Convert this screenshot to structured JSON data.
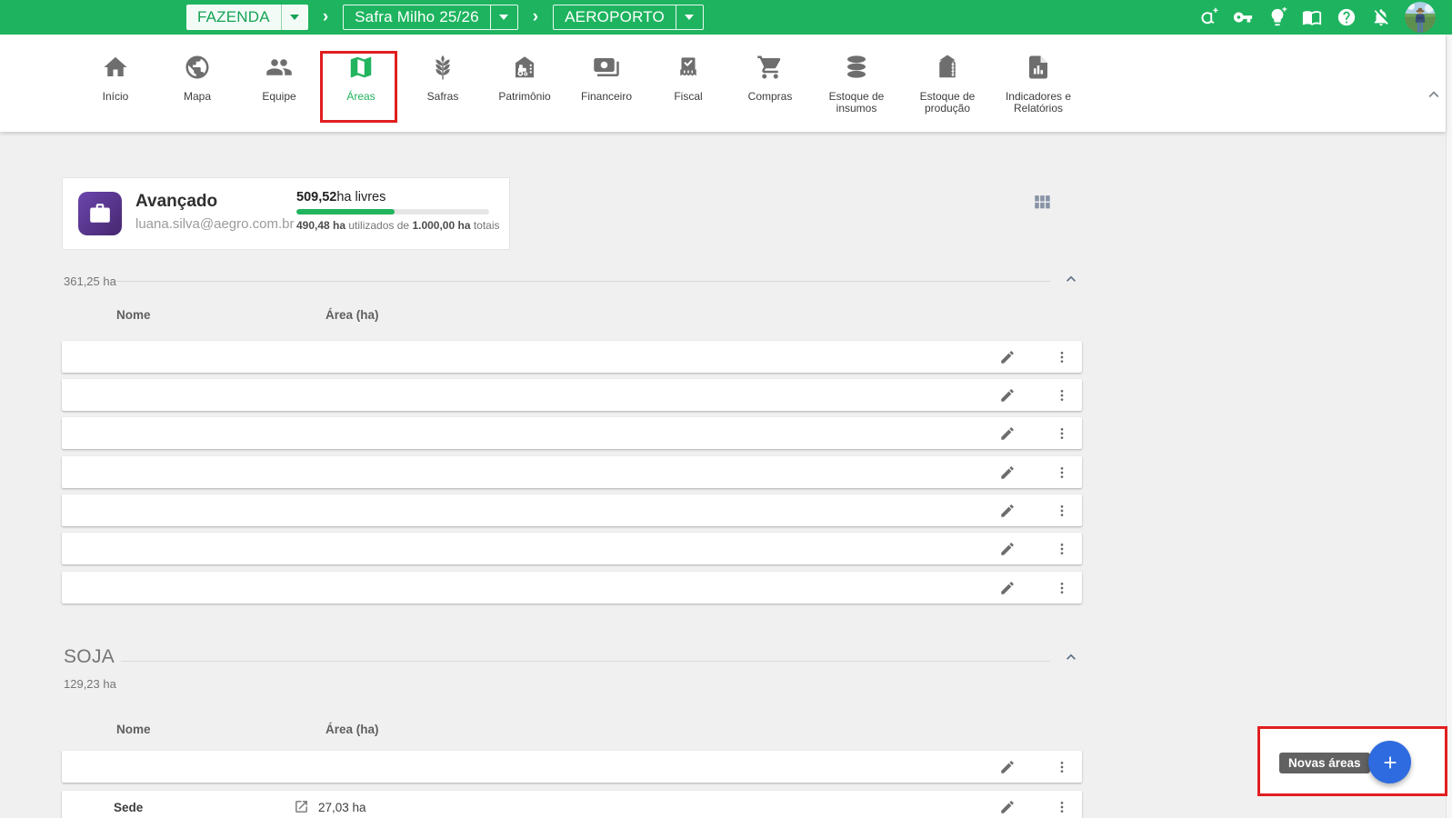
{
  "colors": {
    "brand_green": "#1eb45f",
    "active_green": "#21b55e",
    "plan_purple": "#5a35a0",
    "fab_blue": "#2e6be0",
    "annotation_red": "#e01f1f",
    "tooltip_gray": "#616161"
  },
  "topbar": {
    "farm_selector": {
      "label": "FAZENDA",
      "icon": "chevron-down-icon"
    },
    "separator": "›",
    "season_selector": {
      "label": "Safra Milho 25/26",
      "icon": "chevron-down-icon"
    },
    "field_selector": {
      "label": "AEROPORTO",
      "icon": "chevron-down-icon"
    },
    "action_icons": [
      "aegro-add-icon",
      "key-icon",
      "idea-bulb-icon",
      "guide-book-icon",
      "help-icon",
      "notifications-off-icon"
    ],
    "avatar": "user-photo"
  },
  "nav": {
    "items": [
      {
        "label": "Início",
        "icon": "home-icon",
        "active": false
      },
      {
        "label": "Mapa",
        "icon": "globe-icon",
        "active": false
      },
      {
        "label": "Equipe",
        "icon": "people-icon",
        "active": false
      },
      {
        "label": "Áreas",
        "icon": "folded-map-icon",
        "active": true,
        "annotated": true
      },
      {
        "label": "Safras",
        "icon": "wheat-icon",
        "active": false
      },
      {
        "label": "Patrimônio",
        "icon": "barn-tractor-icon",
        "active": false
      },
      {
        "label": "Financeiro",
        "icon": "banknote-icon",
        "active": false
      },
      {
        "label": "Fiscal",
        "icon": "receipt-check-icon",
        "active": false
      },
      {
        "label": "Compras",
        "icon": "cart-icon",
        "active": false
      },
      {
        "label": "Estoque de insumos",
        "icon": "stacked-discs-icon",
        "active": false
      },
      {
        "label": "Estoque de produção",
        "icon": "silo-icon",
        "active": false
      },
      {
        "label": "Indicadores e Relatórios",
        "icon": "report-chart-icon",
        "active": false
      }
    ],
    "collapse_icon": "chevron-up-icon"
  },
  "plan_card": {
    "plan_name": "Avançado",
    "user_email": "luana.silva@aegro.com.br",
    "free_value": "509,52",
    "free_label": "ha livres",
    "progress_percent": 51,
    "usage": {
      "used": "490,48 ha",
      "mid": " utilizados de ",
      "total": "1.000,00 ha",
      "suffix": " totais"
    }
  },
  "view_toggle_icon": "grid-view-icon",
  "sections": [
    {
      "title": "",
      "subtitle": "361,25 ha",
      "columns": {
        "name": "Nome",
        "area": "Área (ha)"
      },
      "rows": [
        {
          "name": "",
          "area": ""
        },
        {
          "name": "",
          "area": ""
        },
        {
          "name": "",
          "area": ""
        },
        {
          "name": "",
          "area": ""
        },
        {
          "name": "",
          "area": ""
        },
        {
          "name": "",
          "area": ""
        },
        {
          "name": "",
          "area": ""
        }
      ]
    },
    {
      "title": "SOJA",
      "subtitle": "129,23 ha",
      "columns": {
        "name": "Nome",
        "area": "Área (ha)"
      },
      "rows": [
        {
          "name": "",
          "area": ""
        },
        {
          "name": "Sede",
          "area": "27,03 ha",
          "has_link": true
        }
      ]
    }
  ],
  "fab": {
    "tooltip": "Novas áreas",
    "icon": "plus-icon"
  }
}
